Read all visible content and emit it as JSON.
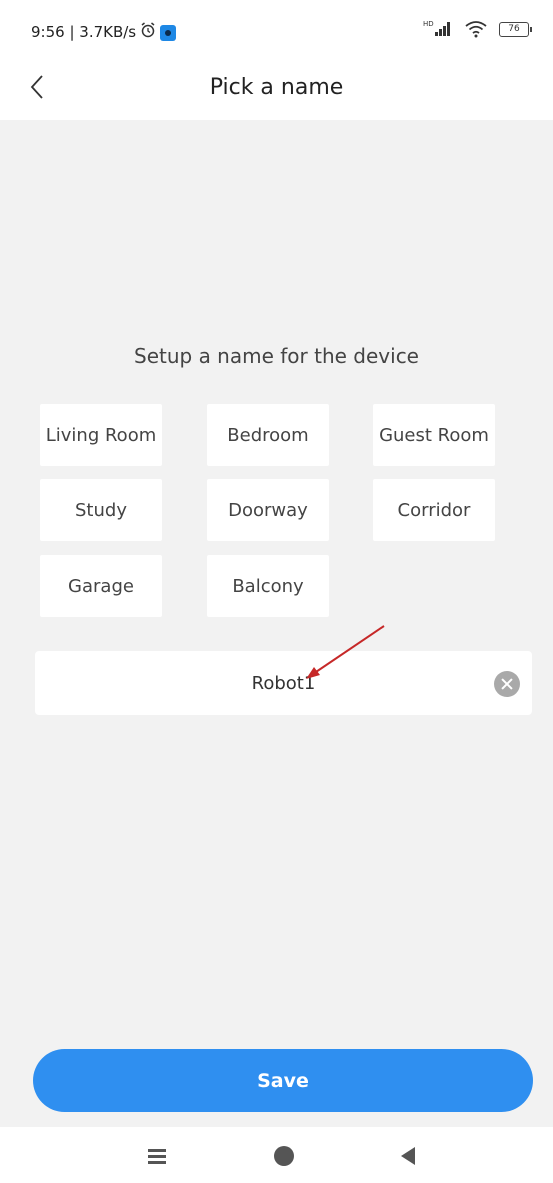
{
  "status_bar": {
    "time_speed": "9:56 | 3.7KB/s",
    "network_tag": "HD",
    "battery_level": "76",
    "icons": [
      "alarm-icon",
      "app-notification-icon",
      "signal-icon",
      "wifi-icon",
      "battery-icon"
    ]
  },
  "header": {
    "title": "Pick a name",
    "back_icon": "chevron-left-icon"
  },
  "main": {
    "prompt": "Setup a name for the device",
    "suggestions": [
      "Living Room",
      "Bedroom",
      "Guest Room",
      "Study",
      "Doorway",
      "Corridor",
      "Garage",
      "Balcony"
    ],
    "name_input": {
      "value": "Robot1",
      "clear_icon": "clear-icon"
    }
  },
  "footer": {
    "save_label": "Save"
  },
  "system_nav": {
    "icons": [
      "menu-icon",
      "home-icon",
      "back-triangle-icon"
    ]
  },
  "colors": {
    "accent": "#2f8ff0",
    "background": "#f2f2f2",
    "annotation": "#c62828"
  }
}
